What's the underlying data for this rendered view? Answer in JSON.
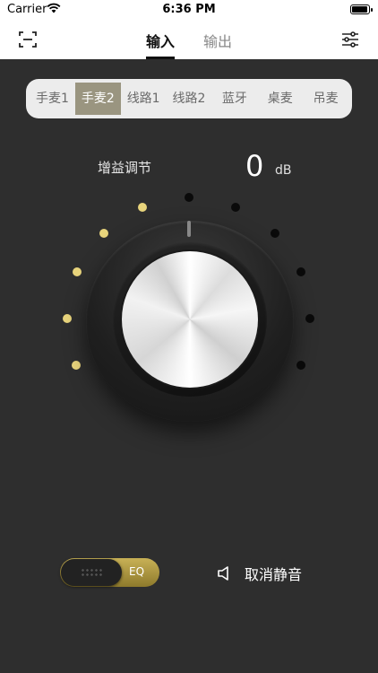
{
  "status_bar": {
    "carrier": "Carrier",
    "time": "6:36 PM"
  },
  "nav": {
    "tabs": [
      {
        "label": "输入",
        "active": true
      },
      {
        "label": "输出",
        "active": false
      }
    ],
    "left_icon": "scan-icon",
    "right_icon": "settings-sliders-icon"
  },
  "sources": {
    "items": [
      "手麦1",
      "手麦2",
      "线路1",
      "线路2",
      "蓝牙",
      "桌麦",
      "吊麦"
    ],
    "selected": "手麦2"
  },
  "gain": {
    "label": "增益调节",
    "value": "0",
    "unit": "dB",
    "lit_dots": 5,
    "total_dots": 11
  },
  "controls": {
    "eq_label": "EQ",
    "mute_label": "取消静音"
  },
  "colors": {
    "accent": "#e8d47c",
    "selected_segment": "#9a9580",
    "background": "#2e2e2e"
  }
}
